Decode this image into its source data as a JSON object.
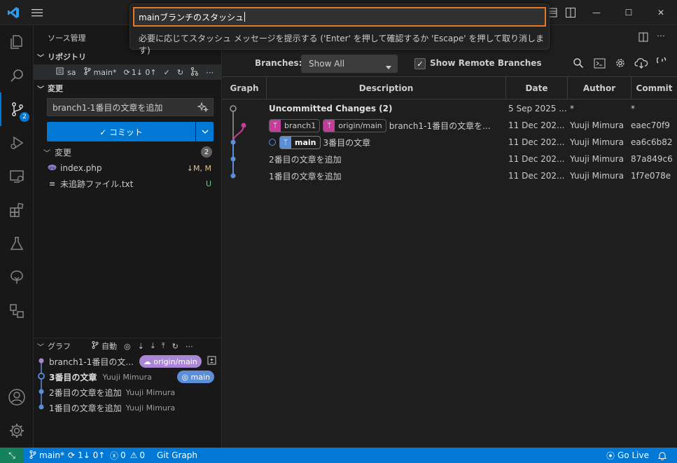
{
  "window": {
    "minimize": "—",
    "maximize": "☐",
    "close": "✕"
  },
  "quick_input": {
    "value": "mainブランチのスタッシュ",
    "message": "必要に応じてスタッシュ メッセージを提示する ('Enter' を押して確認するか 'Escape' を押して取り消します)"
  },
  "activity": {
    "scm_badge": "2"
  },
  "sidebar": {
    "title": "ソース管理",
    "repos_header": "リポジトリ",
    "repo": {
      "name": "sa",
      "branch": "main*",
      "sync": "1↓ 0↑"
    },
    "changes_header": "変更",
    "commit_message": "branch1-1番目の文章を追加",
    "commit_button": "✓ コミット",
    "changes_group": {
      "label": "変更",
      "count": "2"
    },
    "files": [
      {
        "name": "index.php",
        "status": "↓M, M"
      },
      {
        "name": "未追跡ファイル.txt",
        "status": "U"
      }
    ],
    "graph": {
      "header": "グラフ",
      "auto_label": "自動",
      "rows": [
        {
          "message": "branch1-1番目の文...",
          "author": "",
          "ref": "origin/main"
        },
        {
          "message": "3番目の文章",
          "author": "Yuuji Mimura",
          "ref": "main"
        },
        {
          "message": "2番目の文章を追加",
          "author": "Yuuji Mimura",
          "ref": ""
        },
        {
          "message": "1番目の文章を追加",
          "author": "Yuuji Mimura",
          "ref": ""
        }
      ]
    }
  },
  "git_graph": {
    "branches_label": "Branches:",
    "branches_value": "Show All",
    "show_remote_label": "Show Remote Branches",
    "show_remote_checked": "✓",
    "columns": [
      "Graph",
      "Description",
      "Date",
      "Author",
      "Commit"
    ],
    "rows": [
      {
        "description": "Uncommitted Changes (2)",
        "date": "5 Sep 2025 ...",
        "author": "*",
        "commit": "*",
        "refs": []
      },
      {
        "description": "branch1-1番目の文章を...",
        "date": "11 Dec 202...",
        "author": "Yuuji Mimura",
        "commit": "eaec70f9",
        "refs": [
          "branch1",
          "origin/main"
        ]
      },
      {
        "description": "3番目の文章",
        "date": "11 Dec 202...",
        "author": "Yuuji Mimura",
        "commit": "ea6c6b82",
        "refs": [
          "main"
        ]
      },
      {
        "description": "2番目の文章を追加",
        "date": "11 Dec 202...",
        "author": "Yuuji Mimura",
        "commit": "87a849c6",
        "refs": []
      },
      {
        "description": "1番目の文章を追加",
        "date": "11 Dec 202...",
        "author": "Yuuji Mimura",
        "commit": "1f7e078e",
        "refs": []
      }
    ]
  },
  "statusbar": {
    "branch": "main*",
    "sync": "1↓ 0↑",
    "errors": "0",
    "warnings": "0",
    "git_graph": "Git Graph",
    "go_live": "Go Live"
  },
  "colors": {
    "accent": "#0078d4",
    "focus_border": "#e5762a",
    "branch_magenta": "#c53d9b",
    "graph_blue": "#5b8dd9",
    "remote_green": "#16825d"
  }
}
